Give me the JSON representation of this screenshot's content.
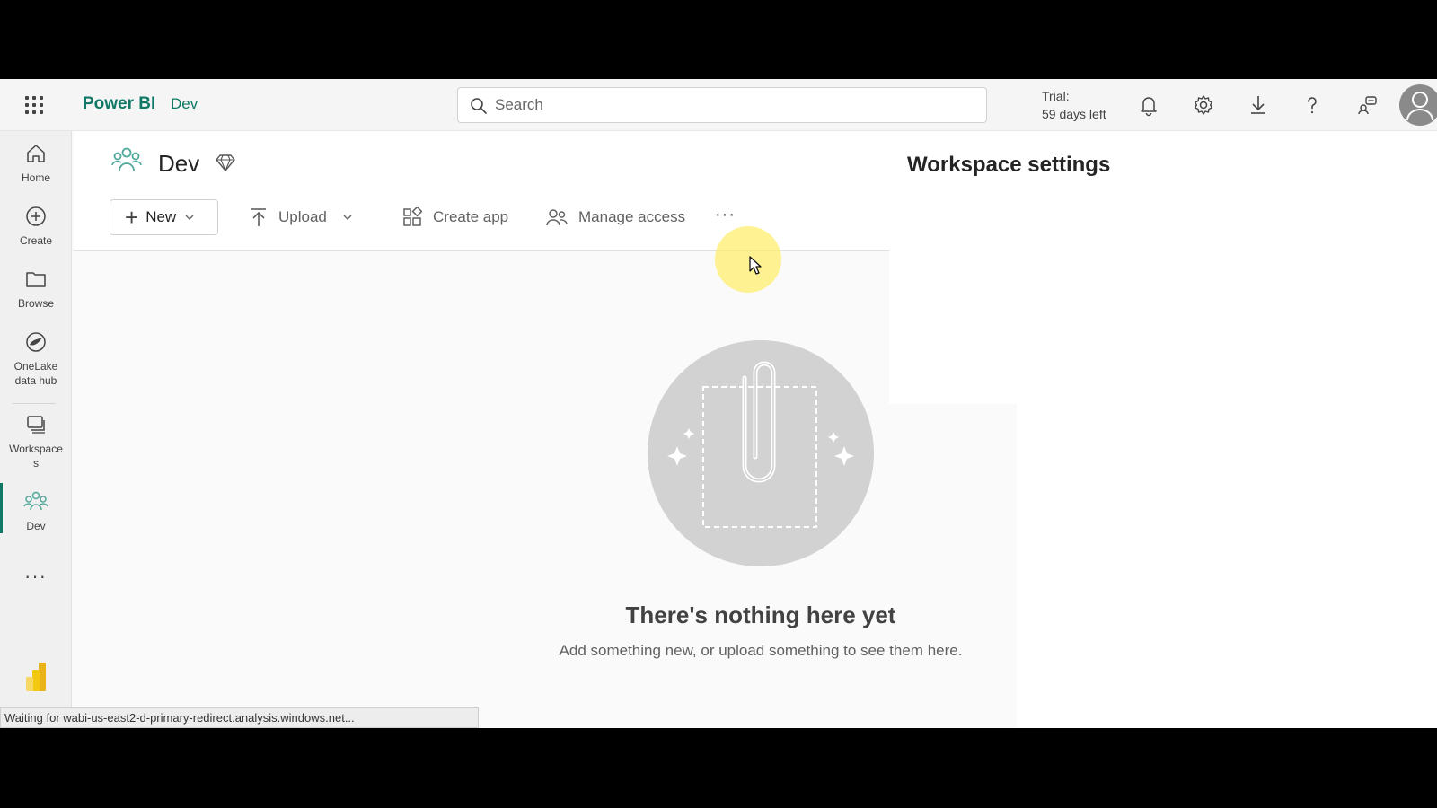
{
  "topbar": {
    "brand": "Power BI",
    "workspace": "Dev",
    "search_placeholder": "Search",
    "trial_line1": "Trial:",
    "trial_line2": "59 days left"
  },
  "rail": {
    "items": [
      {
        "label": "Home",
        "icon": "home-icon"
      },
      {
        "label": "Create",
        "icon": "create-icon"
      },
      {
        "label": "Browse",
        "icon": "folder-icon"
      },
      {
        "label": "OneLake data hub",
        "label1": "OneLake",
        "label2": "data hub",
        "icon": "onelake-icon"
      },
      {
        "label": "Workspaces",
        "label1": "Workspace",
        "label2": "s",
        "icon": "workspaces-icon"
      },
      {
        "label": "Dev",
        "icon": "dev-workspace-icon",
        "active": true
      }
    ],
    "more": "···"
  },
  "workspace": {
    "title": "Dev",
    "commands": {
      "new": "New",
      "upload": "Upload",
      "create_app": "Create app",
      "manage_access": "Manage access",
      "more": "···"
    }
  },
  "empty_state": {
    "title": "There's nothing here yet",
    "subtitle": "Add something new, or upload something to see them here."
  },
  "settings_panel": {
    "title": "Workspace settings"
  },
  "status_bar": {
    "text": "Waiting for wabi-us-east2-d-primary-redirect.analysis.windows.net..."
  },
  "colors": {
    "brand": "#117865",
    "accent_teal": "#4fa89a",
    "cursor_highlight": "#ffee6e"
  }
}
